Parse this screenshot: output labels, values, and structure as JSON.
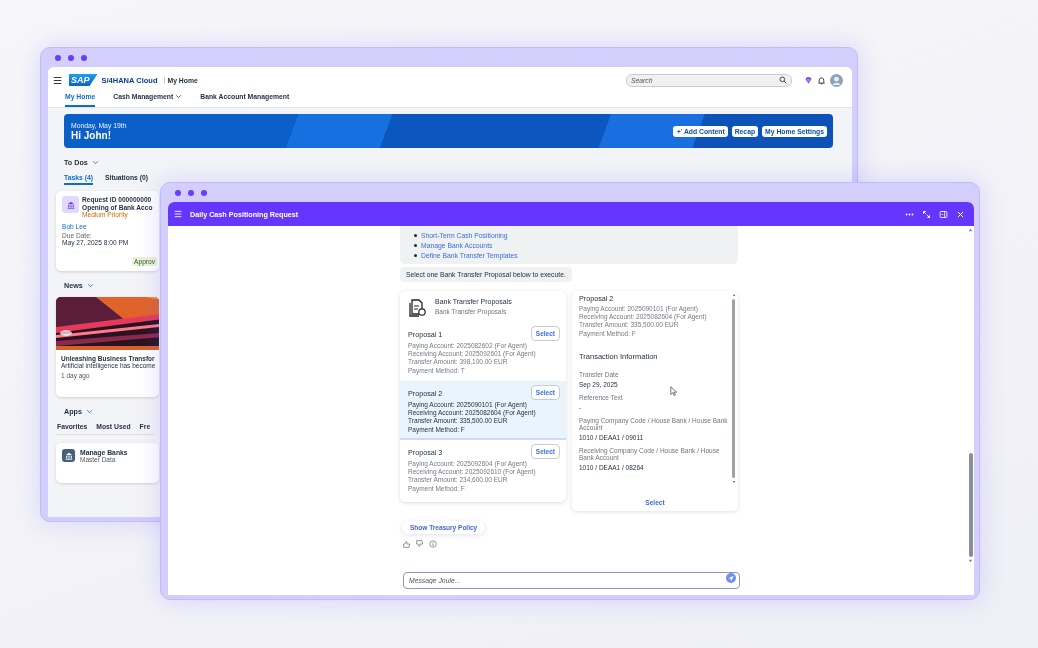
{
  "back_window": {
    "shell": {
      "logo": "SAP",
      "product": "S/4HANA Cloud",
      "page": "My Home",
      "search_placeholder": "Search"
    },
    "tabs": [
      {
        "label": "My Home",
        "selected": true,
        "dropdown": false
      },
      {
        "label": "Cash Management",
        "selected": false,
        "dropdown": true
      },
      {
        "label": "Bank Account Management",
        "selected": false,
        "dropdown": false
      }
    ],
    "banner": {
      "date": "Monday, May 19th",
      "greeting": "Hi John!",
      "buttons": [
        {
          "label": "Add Content",
          "kind": "sparkle"
        },
        {
          "label": "Recap",
          "kind": "plain"
        },
        {
          "label": "My Home Settings",
          "kind": "plain"
        }
      ]
    },
    "todos": {
      "title": "To Dos",
      "tabs": [
        {
          "label": "Tasks (4)",
          "selected": true
        },
        {
          "label": "Situations (0)",
          "selected": false
        }
      ],
      "card": {
        "title_lines": [
          "Request ID 000000000",
          "Opening of Bank Acco"
        ],
        "priority": "Medium Priority",
        "person": "Bob Lee",
        "due_label": "Due Date:",
        "due": "May 27, 2025 8:00 PM",
        "status": "Approv"
      }
    },
    "news": {
      "title": "News",
      "card": {
        "kind": "picture",
        "headline": "Unleashing Business Transfor",
        "summary": "Artificial intelligence has become",
        "age": "1 day ago"
      }
    },
    "apps": {
      "title": "Apps",
      "tabs": [
        {
          "label": "Favorites",
          "selected": false
        },
        {
          "label": "Most Used",
          "selected": false
        },
        {
          "label": "Fre",
          "selected": false
        }
      ],
      "card": {
        "title": "Manage Banks",
        "subtitle": "Master Data"
      }
    }
  },
  "front_window": {
    "title": "Daily Cash Positioning Request",
    "links": [
      "Short-Term Cash Positioning",
      "Manage Bank Accounts",
      "Define Bank Transfer Templates"
    ],
    "instruction": "Select one Bank Transfer Proposal below to execute.",
    "proposals_card": {
      "title": "Bank Transfer Proposals",
      "subtitle": "Bank Transfer Proposals",
      "proposals": [
        {
          "title": "Proposal 1",
          "lines": [
            "Paying Account: 2025082602 (For Agent)",
            "Receiving Account: 2025092601 (For Agent)",
            "Transfer Amount: 398,100.00 EUR",
            "Payment Method: T"
          ],
          "button": "Select",
          "selected": false
        },
        {
          "title": "Proposal 2",
          "lines": [
            "Paying Account: 2025090101 (For Agent)",
            "Receiving Account: 2025082604 (For Agent)",
            "Transfer Amount: 335,500.00 EUR",
            "Payment Method: F"
          ],
          "button": "Select",
          "selected": true
        },
        {
          "title": "Proposal 3",
          "lines": [
            "Paying Account: 2025092604 (For Agent)",
            "Receiving Account: 2025092610 (For Agent)",
            "Transfer Amount: 234,600.00 EUR",
            "Payment Method: F"
          ],
          "button": "Select",
          "selected": false
        }
      ]
    },
    "details": {
      "title": "Proposal 2",
      "lines": [
        "Paying Account: 2025090101 (For Agent)",
        "Receiving Account: 2025082604 (For Agent)",
        "Transfer Amount: 335,500.00 EUR",
        "Payment Method: F"
      ],
      "section": "Transaction Information",
      "fields": [
        {
          "label": "Transfer Date",
          "value": "Sep 29, 2025"
        },
        {
          "label": "Reference Text",
          "value": "-"
        },
        {
          "label": "Paying Company Code / House Bank / House Bank Account",
          "value": "1010 / DEAA1 / 09011"
        },
        {
          "label": "Receiving Company Code / House Bank / House Bank Account",
          "value": "1010 / DEAA1 / 08264"
        }
      ],
      "action": "Select"
    },
    "policy_button": "Show Treasury Policy",
    "message_placeholder": "Message Joule..."
  }
}
